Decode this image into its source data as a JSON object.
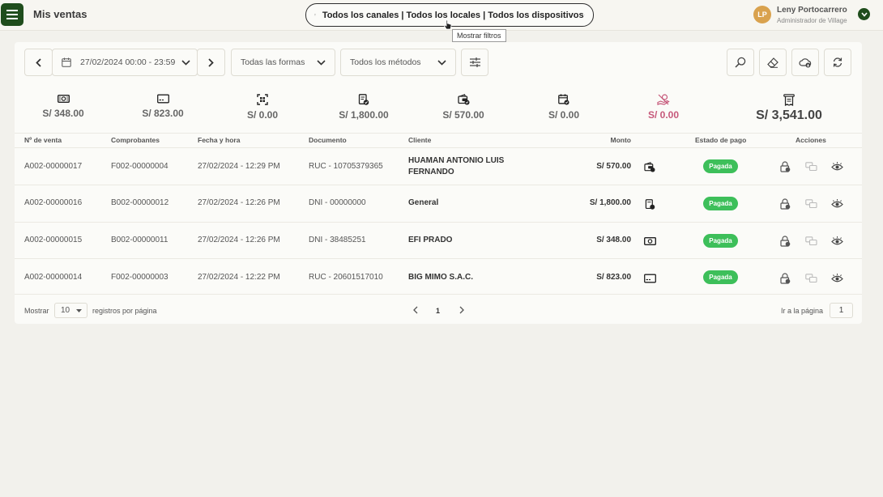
{
  "header": {
    "title": "Mis ventas",
    "filter_text": "Todos los canales | Todos los locales | Todos los dispositivos",
    "tooltip": "Mostrar filtros",
    "user": {
      "initials": "LP",
      "name": "Leny Portocarrero",
      "role": "Administrador de Village"
    }
  },
  "toolbar": {
    "date_range": "27/02/2024 00:00 - 23:59",
    "forms_select": "Todas las formas",
    "methods_select": "Todos los métodos"
  },
  "summary": [
    {
      "icon": "cash-icon",
      "value": "S/ 348.00"
    },
    {
      "icon": "card-icon",
      "value": "S/ 823.00"
    },
    {
      "icon": "qr-icon",
      "value": "S/ 0.00"
    },
    {
      "icon": "transfer-doc-icon",
      "value": "S/ 1,800.00"
    },
    {
      "icon": "wallet-icon",
      "value": "S/ 570.00"
    },
    {
      "icon": "calendar-pay-icon",
      "value": "S/ 0.00"
    },
    {
      "icon": "hand-coin-icon",
      "value": "S/ 0.00"
    },
    {
      "icon": "receipt-total-icon",
      "value": "S/ 3,541.00"
    }
  ],
  "table": {
    "headers": {
      "venta": "Nº de venta",
      "comprobante": "Comprobantes",
      "fecha": "Fecha y hora",
      "documento": "Documento",
      "cliente": "Cliente",
      "monto": "Monto",
      "estado": "Estado de pago",
      "acciones": "Acciones"
    },
    "rows": [
      {
        "venta": "A002-00000017",
        "comprobante": "F002-00000004",
        "fecha": "27/02/2024 - 12:29 PM",
        "documento": "RUC - 10705379365",
        "cliente_l1": "HUAMAN ANTONIO LUIS",
        "cliente_l2": "FERNANDO",
        "monto": "S/ 570.00",
        "metodo_icon": "wallet-icon",
        "estado": "Pagada"
      },
      {
        "venta": "A002-00000016",
        "comprobante": "B002-00000012",
        "fecha": "27/02/2024 - 12:26 PM",
        "documento": "DNI - 00000000",
        "cliente_l1": "General",
        "cliente_l2": "",
        "monto": "S/ 1,800.00",
        "metodo_icon": "transfer-doc-icon",
        "estado": "Pagada"
      },
      {
        "venta": "A002-00000015",
        "comprobante": "B002-00000011",
        "fecha": "27/02/2024 - 12:26 PM",
        "documento": "DNI - 38485251",
        "cliente_l1": "EFI PRADO",
        "cliente_l2": "",
        "monto": "S/ 348.00",
        "metodo_icon": "cash-icon",
        "estado": "Pagada"
      },
      {
        "venta": "A002-00000014",
        "comprobante": "F002-00000003",
        "fecha": "27/02/2024 - 12:22 PM",
        "documento": "RUC - 20601517010",
        "cliente_l1": "BIG MIMO S.A.C.",
        "cliente_l2": "",
        "monto": "S/ 823.00",
        "metodo_icon": "card-icon",
        "estado": "Pagada"
      }
    ]
  },
  "pagination": {
    "show_label": "Mostrar",
    "per_page": "10",
    "per_page_label": "registros por página",
    "current_page": "1",
    "goto_label": "Ir a la página",
    "goto_value": "1"
  }
}
